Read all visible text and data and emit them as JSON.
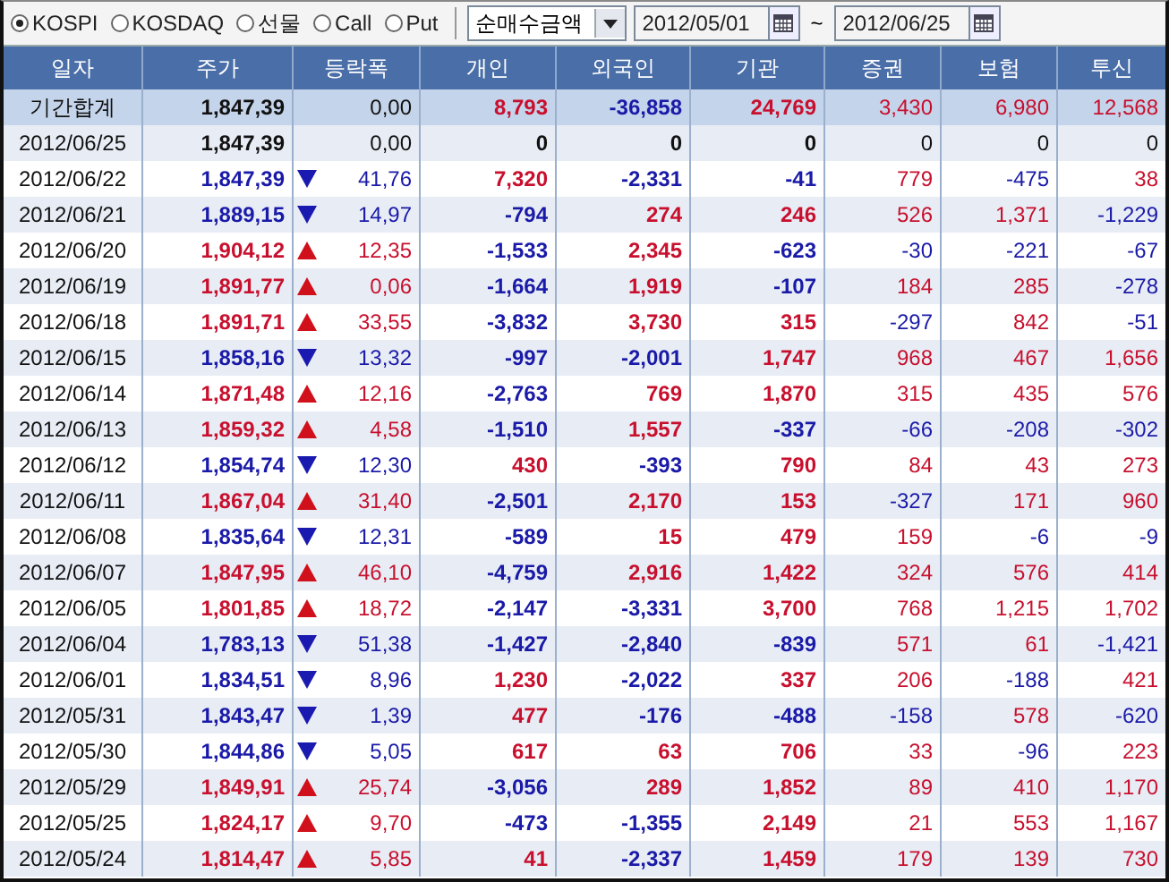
{
  "toolbar": {
    "markets": [
      {
        "label": "KOSPI",
        "selected": true
      },
      {
        "label": "KOSDAQ",
        "selected": false
      },
      {
        "label": "선물",
        "selected": false
      },
      {
        "label": "Call",
        "selected": false
      },
      {
        "label": "Put",
        "selected": false
      }
    ],
    "mode": {
      "value": "순매수금액"
    },
    "start_date": {
      "value": "2012/05/01"
    },
    "separator": "~",
    "end_date": {
      "value": "2012/06/25"
    }
  },
  "table": {
    "columns": [
      "일자",
      "주가",
      "등락폭",
      "개인",
      "외국인",
      "기관",
      "증권",
      "보험",
      "투신"
    ],
    "summary": {
      "date": "기간합계",
      "price": "1,847,39",
      "change": "0,00",
      "values": [
        "8,793",
        "-36,858",
        "24,769",
        "3,430",
        "6,980",
        "12,568"
      ]
    },
    "rows": [
      {
        "date": "2012/06/25",
        "price": "1,847,39",
        "kind": "flat",
        "change": "0,00",
        "values": [
          "0",
          "0",
          "0",
          "0",
          "0",
          "0"
        ]
      },
      {
        "date": "2012/06/22",
        "price": "1,847,39",
        "kind": "down",
        "change": "41,76",
        "values": [
          "7,320",
          "-2,331",
          "-41",
          "779",
          "-475",
          "38"
        ]
      },
      {
        "date": "2012/06/21",
        "price": "1,889,15",
        "kind": "down",
        "change": "14,97",
        "values": [
          "-794",
          "274",
          "246",
          "526",
          "1,371",
          "-1,229"
        ]
      },
      {
        "date": "2012/06/20",
        "price": "1,904,12",
        "kind": "up",
        "change": "12,35",
        "values": [
          "-1,533",
          "2,345",
          "-623",
          "-30",
          "-221",
          "-67"
        ]
      },
      {
        "date": "2012/06/19",
        "price": "1,891,77",
        "kind": "up",
        "change": "0,06",
        "values": [
          "-1,664",
          "1,919",
          "-107",
          "184",
          "285",
          "-278"
        ]
      },
      {
        "date": "2012/06/18",
        "price": "1,891,71",
        "kind": "up",
        "change": "33,55",
        "values": [
          "-3,832",
          "3,730",
          "315",
          "-297",
          "842",
          "-51"
        ]
      },
      {
        "date": "2012/06/15",
        "price": "1,858,16",
        "kind": "down",
        "change": "13,32",
        "values": [
          "-997",
          "-2,001",
          "1,747",
          "968",
          "467",
          "1,656"
        ]
      },
      {
        "date": "2012/06/14",
        "price": "1,871,48",
        "kind": "up",
        "change": "12,16",
        "values": [
          "-2,763",
          "769",
          "1,870",
          "315",
          "435",
          "576"
        ]
      },
      {
        "date": "2012/06/13",
        "price": "1,859,32",
        "kind": "up",
        "change": "4,58",
        "values": [
          "-1,510",
          "1,557",
          "-337",
          "-66",
          "-208",
          "-302"
        ]
      },
      {
        "date": "2012/06/12",
        "price": "1,854,74",
        "kind": "down",
        "change": "12,30",
        "values": [
          "430",
          "-393",
          "790",
          "84",
          "43",
          "273"
        ]
      },
      {
        "date": "2012/06/11",
        "price": "1,867,04",
        "kind": "up",
        "change": "31,40",
        "values": [
          "-2,501",
          "2,170",
          "153",
          "-327",
          "171",
          "960"
        ]
      },
      {
        "date": "2012/06/08",
        "price": "1,835,64",
        "kind": "down",
        "change": "12,31",
        "values": [
          "-589",
          "15",
          "479",
          "159",
          "-6",
          "-9"
        ]
      },
      {
        "date": "2012/06/07",
        "price": "1,847,95",
        "kind": "up",
        "change": "46,10",
        "values": [
          "-4,759",
          "2,916",
          "1,422",
          "324",
          "576",
          "414"
        ]
      },
      {
        "date": "2012/06/05",
        "price": "1,801,85",
        "kind": "up",
        "change": "18,72",
        "values": [
          "-2,147",
          "-3,331",
          "3,700",
          "768",
          "1,215",
          "1,702"
        ]
      },
      {
        "date": "2012/06/04",
        "price": "1,783,13",
        "kind": "down",
        "change": "51,38",
        "values": [
          "-1,427",
          "-2,840",
          "-839",
          "571",
          "61",
          "-1,421"
        ]
      },
      {
        "date": "2012/06/01",
        "price": "1,834,51",
        "kind": "down",
        "change": "8,96",
        "values": [
          "1,230",
          "-2,022",
          "337",
          "206",
          "-188",
          "421"
        ]
      },
      {
        "date": "2012/05/31",
        "price": "1,843,47",
        "kind": "down",
        "change": "1,39",
        "values": [
          "477",
          "-176",
          "-488",
          "-158",
          "578",
          "-620"
        ]
      },
      {
        "date": "2012/05/30",
        "price": "1,844,86",
        "kind": "down",
        "change": "5,05",
        "values": [
          "617",
          "63",
          "706",
          "33",
          "-96",
          "223"
        ]
      },
      {
        "date": "2012/05/29",
        "price": "1,849,91",
        "kind": "up",
        "change": "25,74",
        "values": [
          "-3,056",
          "289",
          "1,852",
          "89",
          "410",
          "1,170"
        ]
      },
      {
        "date": "2012/05/25",
        "price": "1,824,17",
        "kind": "up",
        "change": "9,70",
        "values": [
          "-473",
          "-1,355",
          "2,149",
          "21",
          "553",
          "1,167"
        ]
      },
      {
        "date": "2012/05/24",
        "price": "1,814,47",
        "kind": "up",
        "change": "5,85",
        "values": [
          "41",
          "-2,337",
          "1,459",
          "179",
          "139",
          "730"
        ]
      }
    ]
  }
}
